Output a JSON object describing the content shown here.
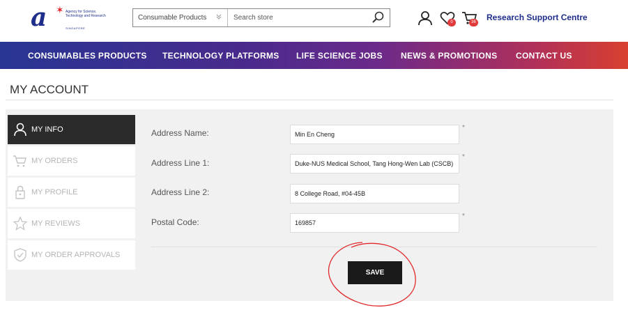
{
  "logo": {
    "text": "Agency for Science, Technology and Research",
    "sub": "SINGAPORE"
  },
  "search": {
    "category": "Consumable Products",
    "placeholder": "Search store"
  },
  "header": {
    "wishlist_count": "0",
    "cart_count": "36",
    "rsc_label": "Research Support Centre"
  },
  "nav": [
    "CONSUMABLES PRODUCTS",
    "TECHNOLOGY PLATFORMS",
    "LIFE SCIENCE JOBS",
    "NEWS & PROMOTIONS",
    "CONTACT US"
  ],
  "page": {
    "title": "MY ACCOUNT"
  },
  "sidebar": {
    "items": [
      {
        "label": "MY INFO",
        "icon": "user-icon",
        "active": true
      },
      {
        "label": "MY ORDERS",
        "icon": "cart-icon",
        "active": false
      },
      {
        "label": "MY PROFILE",
        "icon": "lock-icon",
        "active": false
      },
      {
        "label": "MY REVIEWS",
        "icon": "star-icon",
        "active": false
      },
      {
        "label": "MY ORDER APPROVALS",
        "icon": "shield-check-icon",
        "active": false
      }
    ]
  },
  "form": {
    "fields": [
      {
        "label": "Address Name:",
        "value": "Min En Cheng",
        "required": "*"
      },
      {
        "label": "Address Line 1:",
        "value": "Duke-NUS Medical School, Tang Hong-Wen Lab (CSCB)",
        "required": "*"
      },
      {
        "label": "Address Line 2:",
        "value": "8 College Road, #04-45B",
        "required": ""
      },
      {
        "label": "Postal Code:",
        "value": "169857",
        "required": "*"
      }
    ],
    "save_label": "SAVE"
  },
  "colors": {
    "brand": "#1f2e8a",
    "accent": "#e2232a",
    "annotation": "#e0282a"
  }
}
